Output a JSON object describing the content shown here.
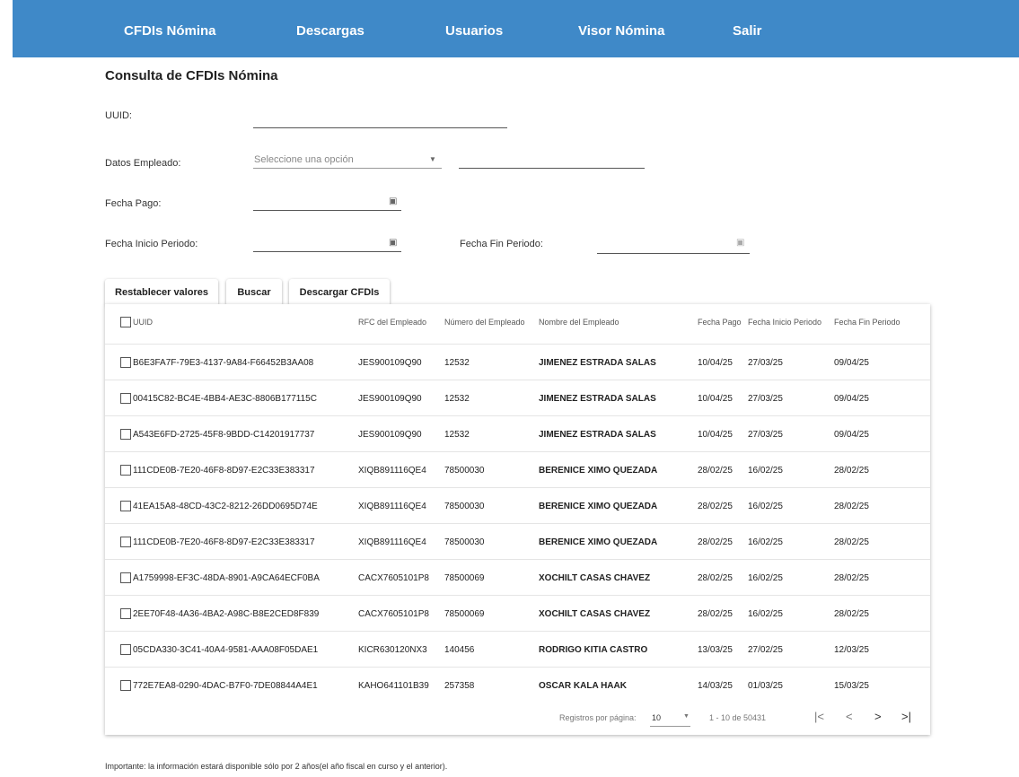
{
  "nav": {
    "items": [
      "CFDIs Nómina",
      "Descargas",
      "Usuarios",
      "Visor Nómina",
      "Salir"
    ]
  },
  "page_title": "Consulta de CFDIs Nómina",
  "form": {
    "uuid_label": "UUID:",
    "uuid_value": "",
    "employee_label": "Datos Empleado:",
    "employee_select_placeholder": "Seleccione una opción",
    "employee_value": "",
    "pay_date_label": "Fecha Pago:",
    "period_start_label": "Fecha Inicio Periodo:",
    "period_end_label": "Fecha Fin Periodo:"
  },
  "buttons": {
    "reset": "Restablecer valores",
    "search": "Buscar",
    "download": "Descargar CFDIs"
  },
  "table": {
    "headers": [
      "UUID",
      "RFC del Empleado",
      "Número del Empleado",
      "Nombre del Empleado",
      "Fecha Pago",
      "Fecha Inicio Periodo",
      "Fecha Fin Periodo"
    ],
    "rows": [
      [
        "B6E3FA7F-79E3-4137-9A84-F66452B3AA08",
        "JES900109Q90",
        "12532",
        "JIMENEZ ESTRADA SALAS",
        "10/04/25",
        "27/03/25",
        "09/04/25"
      ],
      [
        "00415C82-BC4E-4BB4-AE3C-8806B177115C",
        "JES900109Q90",
        "12532",
        "JIMENEZ ESTRADA SALAS",
        "10/04/25",
        "27/03/25",
        "09/04/25"
      ],
      [
        "A543E6FD-2725-45F8-9BDD-C14201917737",
        "JES900109Q90",
        "12532",
        "JIMENEZ ESTRADA SALAS",
        "10/04/25",
        "27/03/25",
        "09/04/25"
      ],
      [
        "111CDE0B-7E20-46F8-8D97-E2C33E383317",
        "XIQB891116QE4",
        "78500030",
        "BERENICE XIMO QUEZADA",
        "28/02/25",
        "16/02/25",
        "28/02/25"
      ],
      [
        "41EA15A8-48CD-43C2-8212-26DD0695D74E",
        "XIQB891116QE4",
        "78500030",
        "BERENICE XIMO QUEZADA",
        "28/02/25",
        "16/02/25",
        "28/02/25"
      ],
      [
        "111CDE0B-7E20-46F8-8D97-E2C33E383317",
        "XIQB891116QE4",
        "78500030",
        "BERENICE XIMO QUEZADA",
        "28/02/25",
        "16/02/25",
        "28/02/25"
      ],
      [
        "A1759998-EF3C-48DA-8901-A9CA64ECF0BA",
        "CACX7605101P8",
        "78500069",
        "XOCHILT CASAS CHAVEZ",
        "28/02/25",
        "16/02/25",
        "28/02/25"
      ],
      [
        "2EE70F48-4A36-4BA2-A98C-B8E2CED8F839",
        "CACX7605101P8",
        "78500069",
        "XOCHILT CASAS CHAVEZ",
        "28/02/25",
        "16/02/25",
        "28/02/25"
      ],
      [
        "05CDA330-3C41-40A4-9581-AAA08F05DAE1",
        "KICR630120NX3",
        "140456",
        "RODRIGO KITIA CASTRO",
        "13/03/25",
        "27/02/25",
        "12/03/25"
      ],
      [
        "772E7EA8-0290-4DAC-B7F0-7DE08844A4E1",
        "KAHO641101B39",
        "257358",
        "OSCAR KALA HAAK",
        "14/03/25",
        "01/03/25",
        "15/03/25"
      ]
    ]
  },
  "pagination": {
    "rows_per_page_label": "Registros por página:",
    "rows_per_page_value": "10",
    "range": "1 - 10 de 50431"
  },
  "footer_note": "Importante: la información estará disponible sólo por 2 años(el año fiscal en curso y el anterior)."
}
